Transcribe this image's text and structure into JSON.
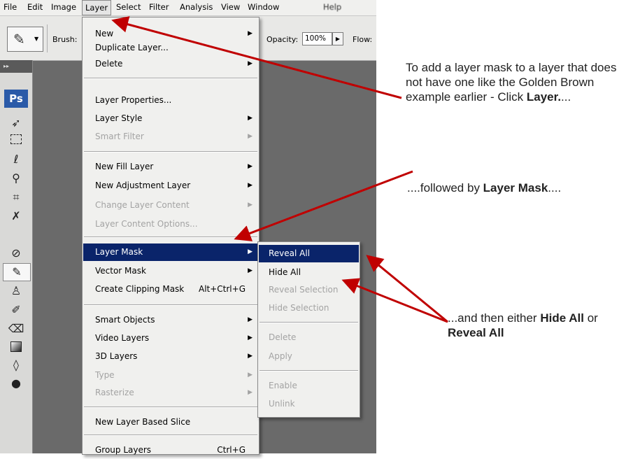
{
  "menubar": {
    "items": [
      "File",
      "Edit",
      "Image",
      "Layer",
      "Select",
      "Filter",
      "Analysis",
      "View",
      "Window",
      "Help"
    ]
  },
  "options_bar": {
    "brush_label": "Brush:",
    "opacity_label": "Opacity:",
    "opacity_value": "100%",
    "flow_label": "Flow:"
  },
  "toolbox": {
    "logo": "Ps",
    "tools": [
      "move-icon",
      "marquee-icon",
      "lasso-icon",
      "magic-wand-icon",
      "crop-icon",
      "slice-icon",
      "healing-brush-icon",
      "brush-icon",
      "clone-stamp-icon",
      "history-brush-icon",
      "eraser-icon",
      "gradient-icon",
      "blur-icon",
      "dodge-icon"
    ]
  },
  "layer_menu": {
    "new": "New",
    "duplicate_layer": "Duplicate Layer...",
    "delete": "Delete",
    "layer_properties": "Layer Properties...",
    "layer_style": "Layer Style",
    "smart_filter": "Smart Filter",
    "new_fill_layer": "New Fill Layer",
    "new_adjustment_layer": "New Adjustment Layer",
    "change_layer_content": "Change Layer Content",
    "layer_content_options": "Layer Content Options...",
    "layer_mask": "Layer Mask",
    "vector_mask": "Vector Mask",
    "create_clipping_mask": "Create Clipping Mask",
    "create_clipping_mask_shortcut": "Alt+Ctrl+G",
    "smart_objects": "Smart Objects",
    "video_layers": "Video Layers",
    "layers_3d": "3D Layers",
    "type": "Type",
    "rasterize": "Rasterize",
    "new_layer_based_slice": "New Layer Based Slice",
    "group_layers": "Group Layers",
    "group_layers_shortcut": "Ctrl+G"
  },
  "layer_mask_submenu": {
    "reveal_all": "Reveal All",
    "hide_all": "Hide All",
    "reveal_selection": "Reveal Selection",
    "hide_selection": "Hide Selection",
    "delete": "Delete",
    "apply": "Apply",
    "enable": "Enable",
    "unlink": "Unlink"
  },
  "annotations": {
    "a1_text": "To add a layer mask to a layer that does not have one like the Golden Brown example earlier - Click ",
    "a1_bold": "Layer.",
    "a1_tail": "...",
    "a2_text": "....followed by ",
    "a2_bold": "Layer Mask",
    "a2_tail": "....",
    "a3_text": "...and then either ",
    "a3_bold1": "Hide All",
    "a3_mid": " or ",
    "a3_bold2": "Reveal All"
  },
  "colors": {
    "highlight": "#0a246a",
    "arrow": "#c00000"
  }
}
